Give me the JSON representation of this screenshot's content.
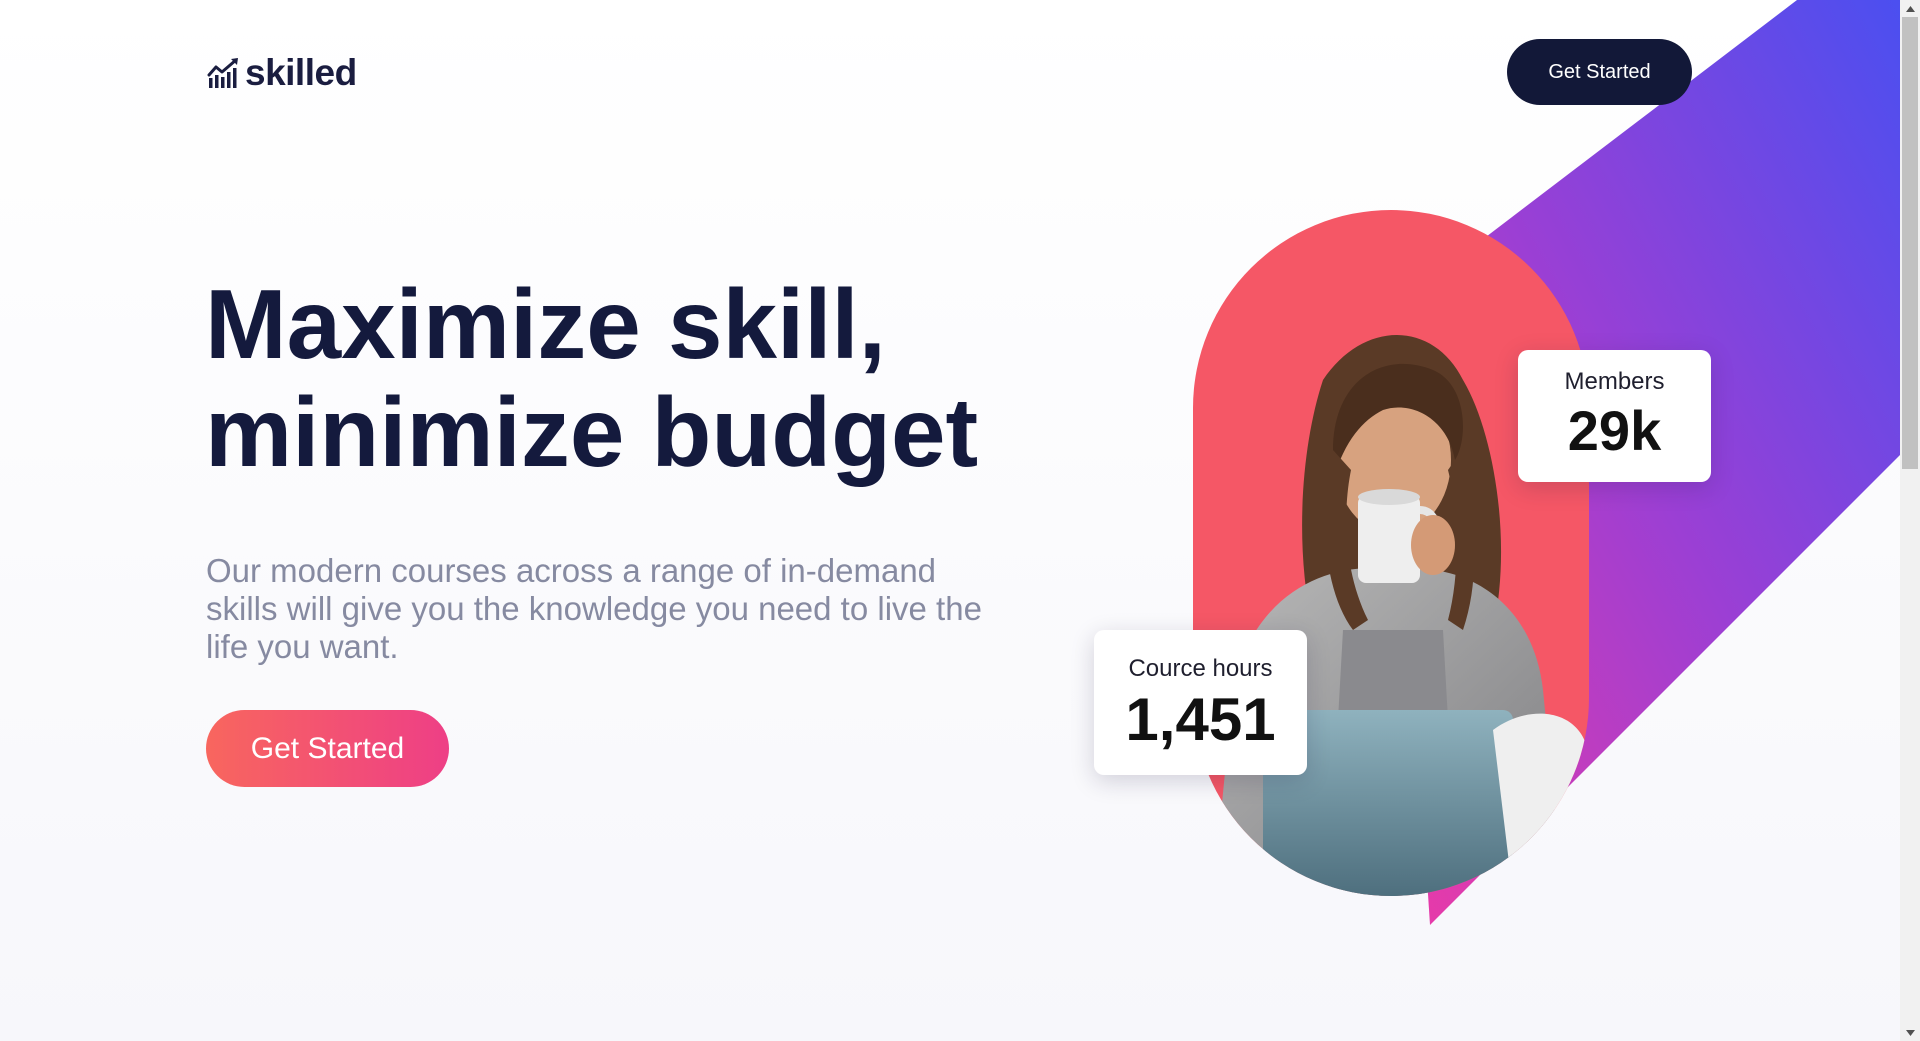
{
  "header": {
    "logo_text": "skilled",
    "logo_icon": "chart-growth-icon",
    "cta_label": "Get Started"
  },
  "hero": {
    "title_line1": "Maximize skill,",
    "title_line2": "minimize budget",
    "description": "Our modern courses across a range of in-demand skills will give you the knowledge you need to live the life you want.",
    "cta_label": "Get Started"
  },
  "stats": {
    "members": {
      "label": "Members",
      "value": "29k"
    },
    "hours": {
      "label": "Cource hours",
      "value": "1,451"
    }
  },
  "colors": {
    "navy": "#121838",
    "title": "#141a3d",
    "muted": "#868aa1",
    "coral": "#f55766",
    "cta_start": "#f8665e",
    "cta_end": "#ee3f86",
    "band_start": "#e8409c",
    "band_end": "#4b4ff0"
  }
}
